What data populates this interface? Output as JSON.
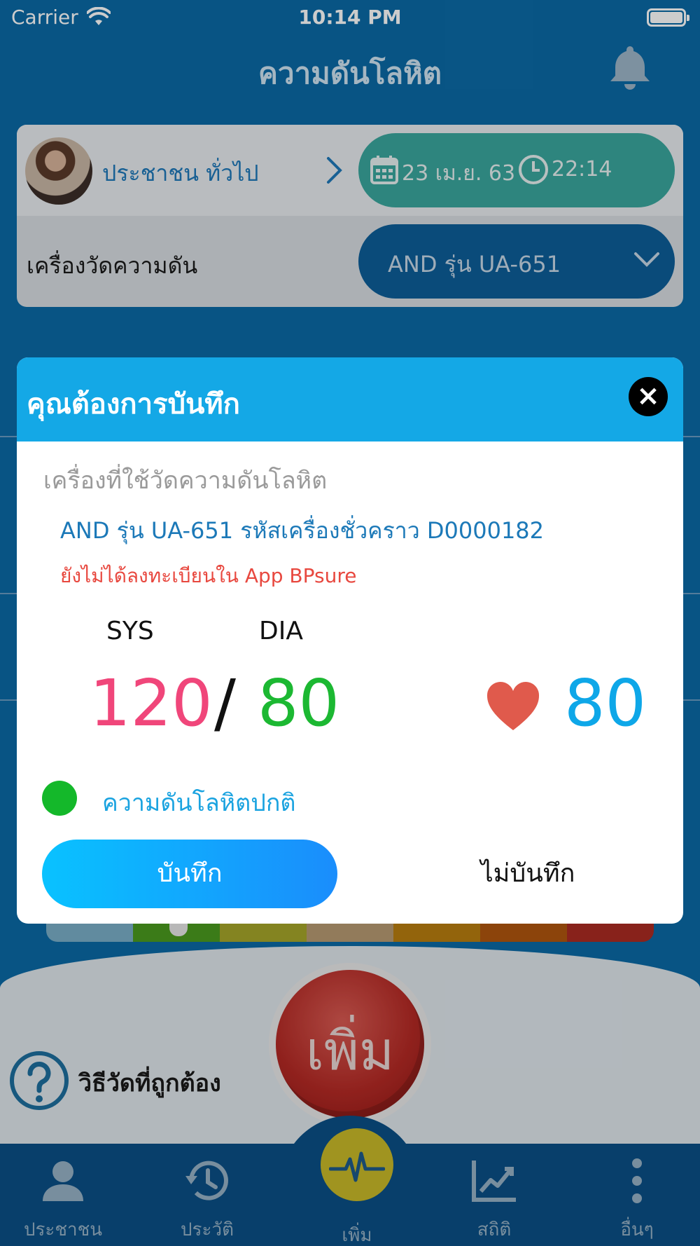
{
  "status_bar": {
    "carrier": "Carrier",
    "time": "10:14 PM"
  },
  "header": {
    "title": "ความดันโลหิต"
  },
  "patient": {
    "name": "ประชาชน ทั่วไป",
    "date": "23 เม.ย. 63",
    "time": "22:14"
  },
  "device_row": {
    "label": "เครื่องวัดความดัน",
    "selected": "AND รุ่น UA-651"
  },
  "bottom": {
    "help_text": "วิธีวัดที่ถูกต้อง",
    "add_button": "เพิ่ม"
  },
  "tabs": [
    {
      "label": "ประชาชน",
      "icon": "person-icon"
    },
    {
      "label": "ประวัติ",
      "icon": "history-icon"
    },
    {
      "label": "เพิ่ม",
      "icon": "pulse-icon"
    },
    {
      "label": "สถิติ",
      "icon": "chart-icon"
    },
    {
      "label": "อื่นๆ",
      "icon": "more-icon"
    }
  ],
  "modal": {
    "title": "คุณต้องการบันทึก",
    "close": "×",
    "device_section_label": "เครื่องที่ใช้วัดความดันโลหิต",
    "device_info": "AND รุ่น UA-651 รหัสเครื่องชั่วคราว D0000182",
    "warning": "ยังไม่ได้ลงทะเบียนใน App BPsure",
    "sys_label": "SYS",
    "dia_label": "DIA",
    "sys_value": "120",
    "separator": "/",
    "dia_value": "80",
    "pulse_value": "80",
    "status_text": "ความดันโลหิตปกติ",
    "save_label": "บันทึก",
    "nosave_label": "ไม่บันทึก"
  },
  "colors": {
    "header_blue": "#14a8e6",
    "sys_pink": "#f0467a",
    "dia_green": "#1cb832",
    "pulse_blue": "#0ea7e8",
    "heart_red": "#e05a4c",
    "status_green": "#14b82a",
    "warning_red": "#e8483f"
  }
}
